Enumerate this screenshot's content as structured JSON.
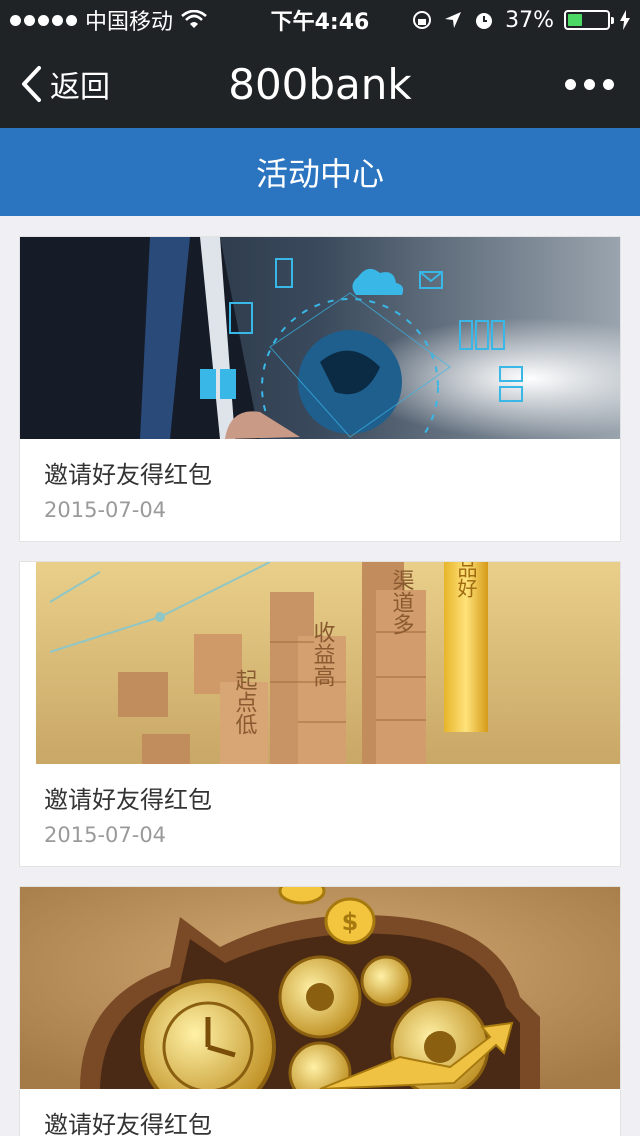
{
  "status_bar": {
    "carrier": "中国移动",
    "time": "下午4:46",
    "battery_percent": "37%",
    "battery_level": 0.37,
    "battery_color": "#4cd964"
  },
  "nav": {
    "back_label": "返回",
    "title": "800bank",
    "more_icon": "more-dots-icon"
  },
  "header": {
    "title": "活动中心",
    "color": "#2a74c0"
  },
  "cards": [
    {
      "title": "邀请好友得红包",
      "date": "2015-07-04"
    },
    {
      "title": "邀请好友得红包",
      "date": "2015-07-04"
    },
    {
      "title": "邀请好友得红包",
      "date": ""
    }
  ],
  "card2_image": {
    "block1": "起点低",
    "block2": "收益高",
    "block3": "渠道多",
    "gold": "产品好"
  }
}
